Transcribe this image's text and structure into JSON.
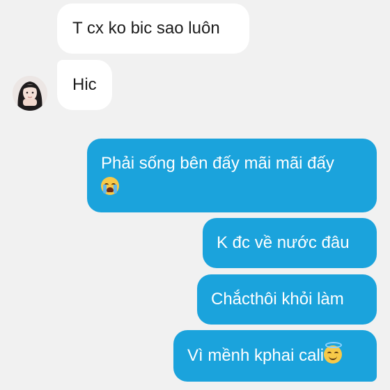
{
  "messages": [
    {
      "direction": "incoming",
      "text": "T cx ko bic sao luôn"
    },
    {
      "direction": "incoming",
      "text": "Hic"
    },
    {
      "direction": "outgoing",
      "text": "Phải sống bên đấy mãi mãi đấy",
      "emoji": "loudly-crying-face-icon"
    },
    {
      "direction": "outgoing",
      "text": "K đc về nước đâu"
    },
    {
      "direction": "outgoing",
      "text": "Chắcthôi khỏi làm"
    },
    {
      "direction": "outgoing",
      "text": "Vì mềnh kphai cali",
      "emoji": "smiling-face-with-halo-icon"
    }
  ],
  "colors": {
    "background": "#f1f1f1",
    "incoming_bubble": "#ffffff",
    "outgoing_bubble": "#1ba3dc"
  }
}
